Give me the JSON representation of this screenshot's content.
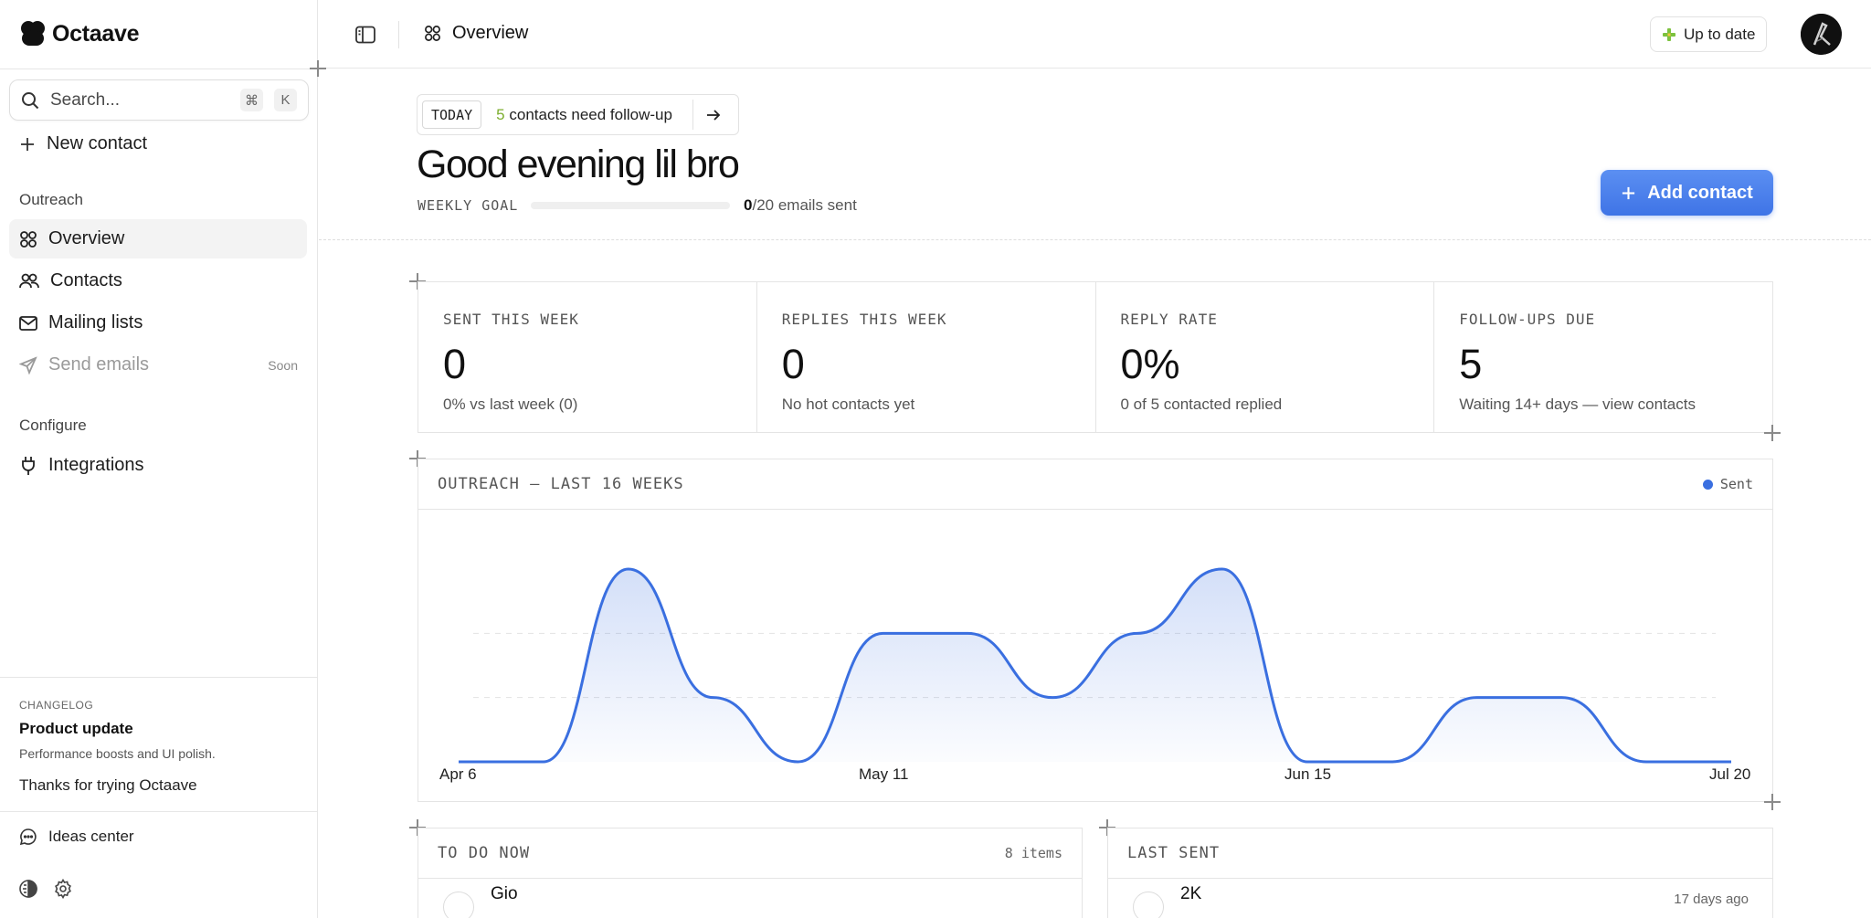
{
  "app": {
    "name": "Octaave"
  },
  "sidebar": {
    "search": {
      "placeholder": "Search...",
      "shortcut_mod": "⌘",
      "shortcut_key": "K"
    },
    "new_contact": "New contact",
    "outreach_label": "Outreach",
    "items": [
      {
        "label": "Overview",
        "icon": "grid-icon",
        "active": true
      },
      {
        "label": "Contacts",
        "icon": "users-icon"
      },
      {
        "label": "Mailing lists",
        "icon": "mail-icon"
      },
      {
        "label": "Send emails",
        "icon": "send-icon",
        "badge": "Soon",
        "disabled": true
      }
    ],
    "configure_label": "Configure",
    "integrations": "Integrations",
    "changelog": {
      "kicker": "CHANGELOG",
      "title": "Product update",
      "body": "Performance boosts and UI polish."
    },
    "thanks": "Thanks for trying Octaave",
    "ideas": "Ideas center"
  },
  "topbar": {
    "breadcrumb": "Overview",
    "status": "Up to date"
  },
  "header": {
    "today_tag": "TODAY",
    "followup_count": "5",
    "followup_text": "contacts need follow-up",
    "greeting": "Good evening lil bro",
    "goal_label": "WEEKLY GOAL",
    "goal_sent": "0",
    "goal_rest": "/20 emails sent",
    "goal_progress": 0,
    "add_contact": "Add contact"
  },
  "stats": [
    {
      "label": "SENT THIS WEEK",
      "value": "0",
      "sub": "0% vs last week (0)"
    },
    {
      "label": "REPLIES THIS WEEK",
      "value": "0",
      "sub": "No hot contacts yet"
    },
    {
      "label": "REPLY RATE",
      "value": "0%",
      "sub": "0 of 5 contacted replied"
    },
    {
      "label": "FOLLOW-UPS DUE",
      "value": "5",
      "sub": "Waiting 14+ days — view contacts"
    }
  ],
  "chart_data": {
    "type": "area",
    "title": "OUTREACH — LAST 16 WEEKS",
    "xlabel": "",
    "ylabel": "",
    "x_ticks": [
      "Apr 6",
      "May 11",
      "Jun 15",
      "Jul 20"
    ],
    "x": [
      "Apr 6",
      "Apr 13",
      "Apr 20",
      "Apr 27",
      "May 4",
      "May 11",
      "May 18",
      "May 25",
      "Jun 1",
      "Jun 8",
      "Jun 15",
      "Jun 22",
      "Jun 29",
      "Jul 6",
      "Jul 13",
      "Jul 20"
    ],
    "series": [
      {
        "name": "Sent",
        "color": "#3a6fe0",
        "values": [
          0,
          0,
          3,
          1,
          0,
          2,
          2,
          1,
          2,
          3,
          0,
          0,
          1,
          1,
          0,
          0
        ]
      }
    ],
    "ylim": [
      0,
      3
    ],
    "grid": true,
    "legend": "top-right"
  },
  "todo": {
    "title": "TO DO NOW",
    "count": "8 items",
    "first_row": "Gio"
  },
  "last_sent": {
    "title": "LAST SENT",
    "first_row": "2K",
    "first_time": "17 days ago"
  }
}
